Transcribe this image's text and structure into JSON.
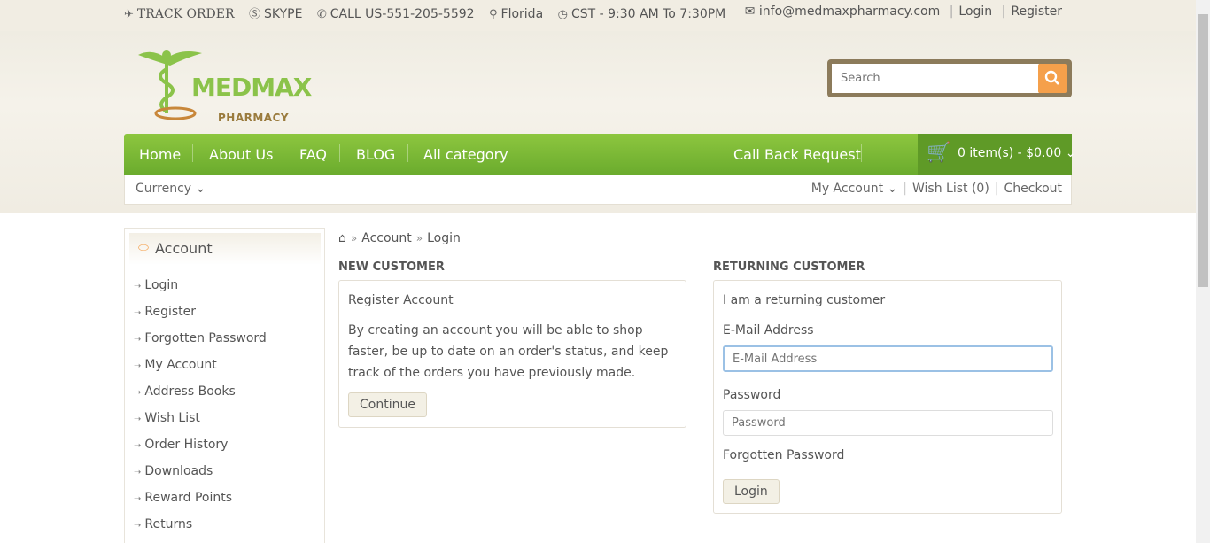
{
  "topbar": {
    "track": "TRACK ORDER",
    "skype": "SKYPE",
    "call": "CALL US-551-205-5592",
    "location": "Florida",
    "hours": "CST - 9:30 AM To 7:30PM",
    "email": "info@medmaxpharmacy.com",
    "login": "Login",
    "register": "Register"
  },
  "logo": {
    "name": "MEDMAX",
    "sub": "PHARMACY"
  },
  "search": {
    "placeholder": "Search"
  },
  "nav": {
    "home": "Home",
    "about": "About Us",
    "faq": "FAQ",
    "blog": "BLOG",
    "category": "All category",
    "callback": "Call Back Request",
    "cart": "0 item(s) - $0.00"
  },
  "subbar": {
    "currency": "Currency",
    "my_account": "My Account",
    "wishlist": "Wish List (0)",
    "checkout": "Checkout"
  },
  "sidebar": {
    "title": "Account",
    "items": [
      "Login",
      "Register",
      "Forgotten Password",
      "My Account",
      "Address Books",
      "Wish List",
      "Order History",
      "Downloads",
      "Reward Points",
      "Returns"
    ]
  },
  "breadcrumb": {
    "account": "Account",
    "login": "Login"
  },
  "new_customer": {
    "heading": "NEW CUSTOMER",
    "title": "Register Account",
    "text": "By creating an account you will be able to shop faster, be up to date on an order's status, and keep track of the orders you have previously made.",
    "button": "Continue"
  },
  "returning": {
    "heading": "RETURNING CUSTOMER",
    "title": "I am a returning customer",
    "email_label": "E-Mail Address",
    "email_placeholder": "E-Mail Address",
    "password_label": "Password",
    "password_placeholder": "Password",
    "forgot": "Forgotten Password",
    "button": "Login"
  },
  "colors": {
    "green": "#7ab935",
    "orange": "#f5a04b",
    "brown": "#8c7b5b"
  }
}
